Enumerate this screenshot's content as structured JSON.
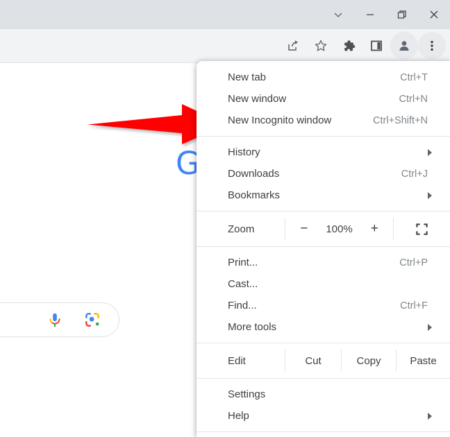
{
  "window": {
    "controls": [
      {
        "name": "tab-search-chevron",
        "icon": "chevron-down-icon"
      },
      {
        "name": "minimize",
        "icon": "minimize-icon"
      },
      {
        "name": "restore",
        "icon": "restore-icon"
      },
      {
        "name": "close",
        "icon": "close-icon"
      }
    ]
  },
  "toolbar": {
    "icons": [
      {
        "name": "share-icon"
      },
      {
        "name": "bookmark-star-icon"
      },
      {
        "name": "extensions-puzzle-icon"
      },
      {
        "name": "side-panel-icon"
      },
      {
        "name": "profile-avatar-icon"
      },
      {
        "name": "three-dot-menu-icon"
      }
    ]
  },
  "page": {
    "logo_text": "G",
    "search_placeholder": "",
    "search_value": "",
    "mic_icon": "microphone-icon",
    "lens_icon": "google-lens-icon"
  },
  "annotation": {
    "arrow_color": "#fe0000",
    "points_at": "New Incognito window"
  },
  "menu": {
    "groups": [
      {
        "id": "new",
        "items": [
          {
            "label": "New tab",
            "accel": "Ctrl+T",
            "submenu": false
          },
          {
            "label": "New window",
            "accel": "Ctrl+N",
            "submenu": false
          },
          {
            "label": "New Incognito window",
            "accel": "Ctrl+Shift+N",
            "submenu": false
          }
        ]
      },
      {
        "id": "browse",
        "items": [
          {
            "label": "History",
            "accel": "",
            "submenu": true
          },
          {
            "label": "Downloads",
            "accel": "Ctrl+J",
            "submenu": false
          },
          {
            "label": "Bookmarks",
            "accel": "",
            "submenu": true
          }
        ]
      }
    ],
    "zoom_row": {
      "label": "Zoom",
      "minus": "−",
      "level": "100%",
      "plus": "+",
      "fullscreen_icon": "fullscreen-icon"
    },
    "tools_group": {
      "items": [
        {
          "label": "Print...",
          "accel": "Ctrl+P",
          "submenu": false
        },
        {
          "label": "Cast...",
          "accel": "",
          "submenu": false
        },
        {
          "label": "Find...",
          "accel": "Ctrl+F",
          "submenu": false
        },
        {
          "label": "More tools",
          "accel": "",
          "submenu": true
        }
      ]
    },
    "edit_row": {
      "label": "Edit",
      "cut": "Cut",
      "copy": "Copy",
      "paste": "Paste"
    },
    "settings_group": {
      "items": [
        {
          "label": "Settings",
          "accel": "",
          "submenu": false
        },
        {
          "label": "Help",
          "accel": "",
          "submenu": true
        }
      ]
    }
  },
  "colors": {
    "tab_strip": "#dee1e6",
    "toolbar": "#f1f3f4",
    "menu_bg": "#ffffff",
    "accel_text": "#80868b",
    "arrow_red": "#fe0000",
    "google_blue": "#4285f4"
  }
}
